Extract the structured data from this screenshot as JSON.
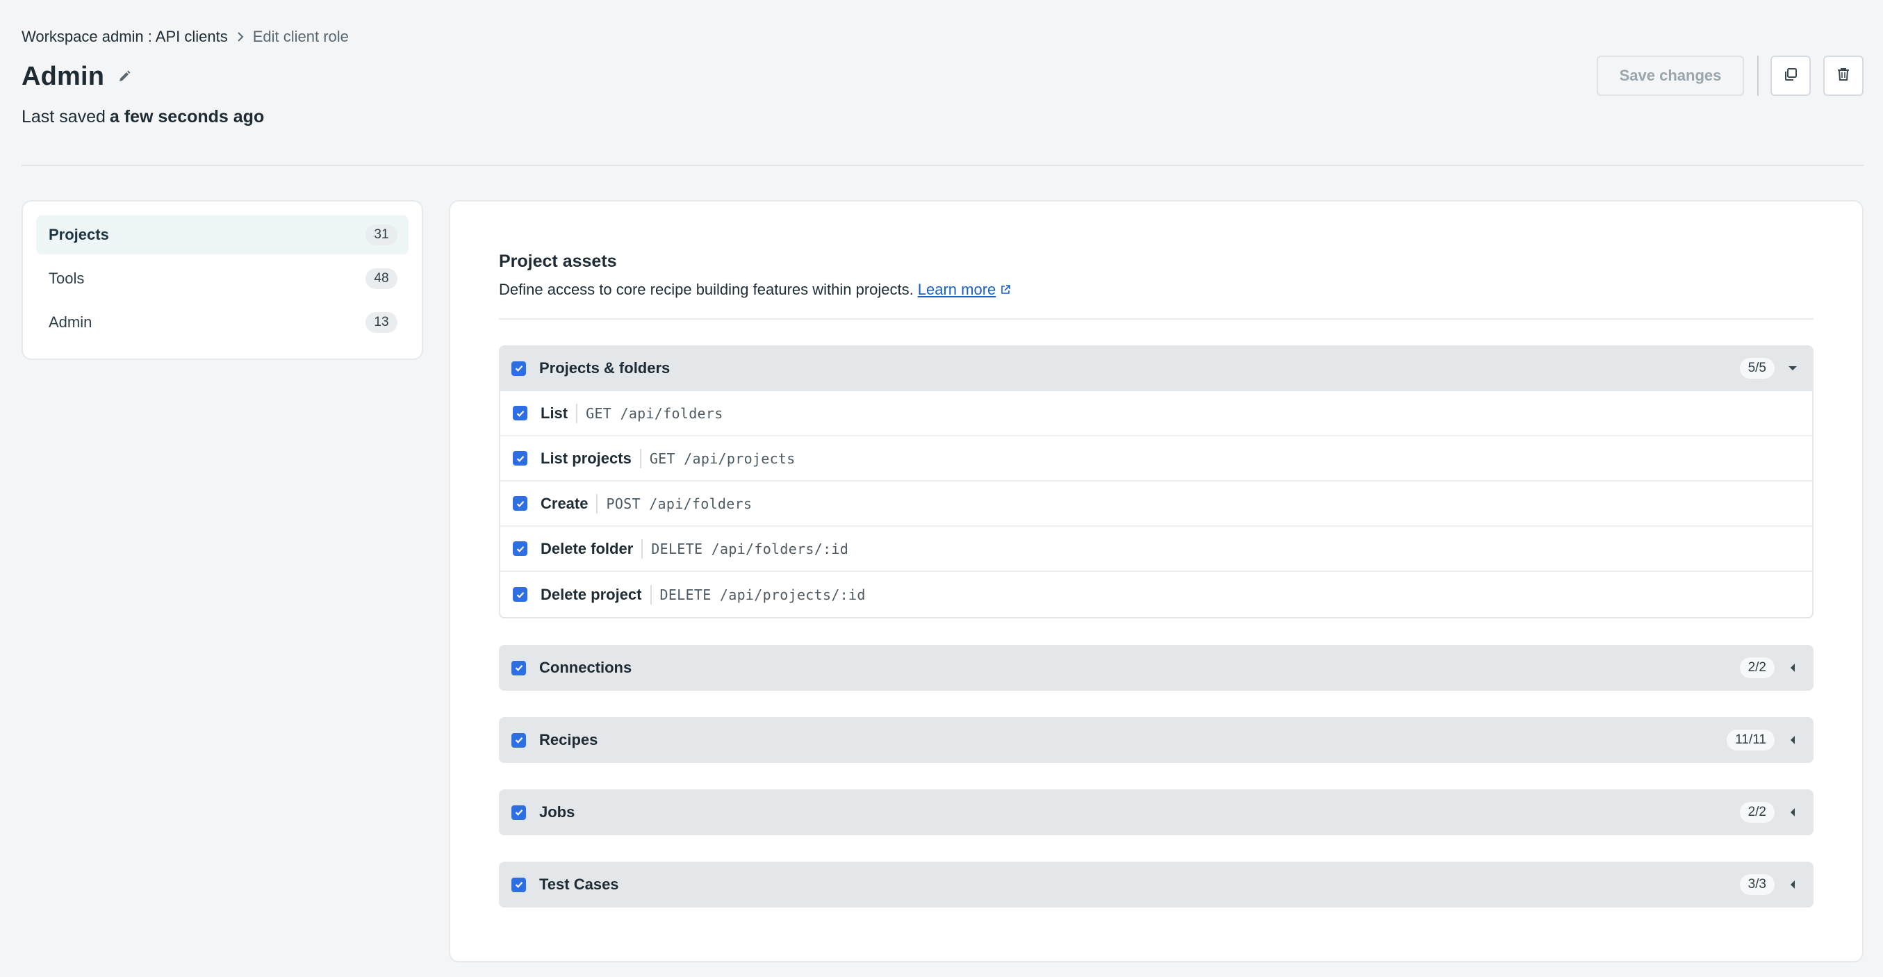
{
  "breadcrumb": {
    "root": "Workspace admin : API clients",
    "current": "Edit client role"
  },
  "header": {
    "title": "Admin",
    "last_saved_prefix": "Last saved",
    "last_saved_value": "a few seconds ago",
    "save_label": "Save changes"
  },
  "sidebar": {
    "items": [
      {
        "label": "Projects",
        "count": "31",
        "active": true
      },
      {
        "label": "Tools",
        "count": "48",
        "active": false
      },
      {
        "label": "Admin",
        "count": "13",
        "active": false
      }
    ]
  },
  "section": {
    "title": "Project assets",
    "description": "Define access to core recipe building features within projects.",
    "link_label": "Learn more"
  },
  "groups": [
    {
      "label": "Projects & folders",
      "count": "5/5",
      "expanded": true,
      "permissions": [
        {
          "name": "List",
          "endpoint": "GET /api/folders"
        },
        {
          "name": "List projects",
          "endpoint": "GET /api/projects"
        },
        {
          "name": "Create",
          "endpoint": "POST /api/folders"
        },
        {
          "name": "Delete folder",
          "endpoint": "DELETE /api/folders/:id"
        },
        {
          "name": "Delete project",
          "endpoint": "DELETE /api/projects/:id"
        }
      ]
    },
    {
      "label": "Connections",
      "count": "2/2",
      "expanded": false
    },
    {
      "label": "Recipes",
      "count": "11/11",
      "expanded": false
    },
    {
      "label": "Jobs",
      "count": "2/2",
      "expanded": false
    },
    {
      "label": "Test Cases",
      "count": "3/3",
      "expanded": false
    }
  ],
  "colors": {
    "accent": "#2d6fe3",
    "link": "#1a5fc4",
    "background": "#f3f5f7"
  },
  "icons": [
    "chevron-right-icon",
    "pencil-icon",
    "copy-icon",
    "trash-icon",
    "external-link-icon",
    "checkbox-checked-icon",
    "caret-down-icon",
    "caret-left-icon"
  ]
}
